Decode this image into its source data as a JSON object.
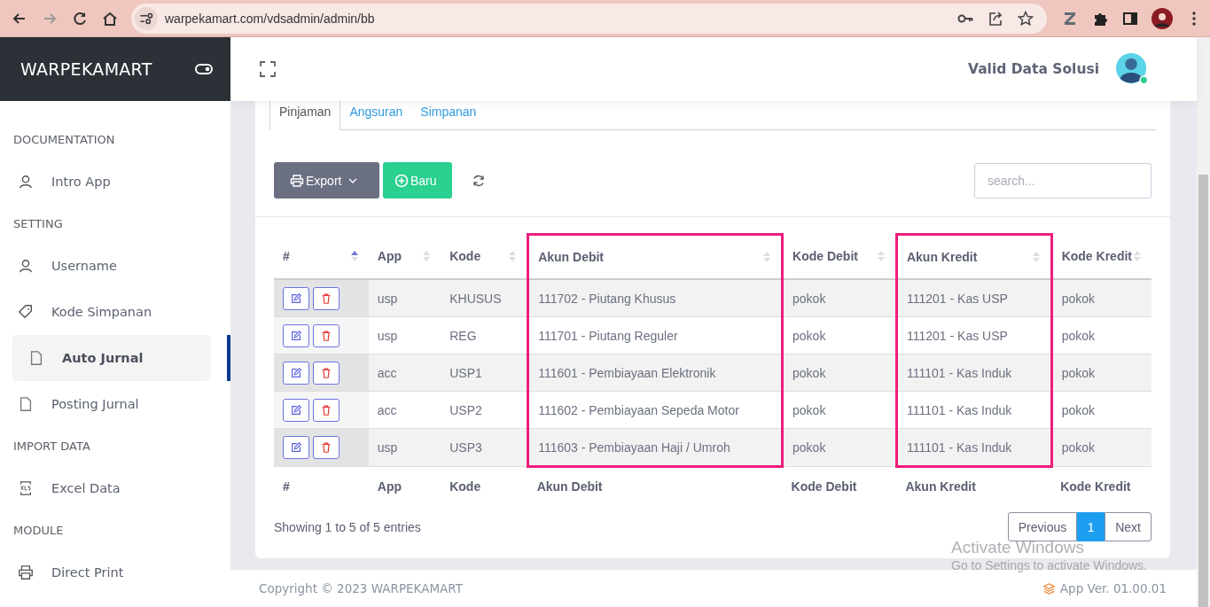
{
  "browser": {
    "url": "warpekamart.com/vdsadmin/admin/bb",
    "forward_disabled": true
  },
  "sidebar": {
    "brand": "WARPEKAMART",
    "sections": [
      {
        "title": "DOCUMENTATION",
        "items": [
          {
            "label": "Intro App",
            "kind": "user",
            "selected": false
          }
        ]
      },
      {
        "title": "SETTING",
        "items": [
          {
            "label": "Username",
            "kind": "user",
            "selected": false
          },
          {
            "label": "Kode Simpanan",
            "kind": "tag",
            "selected": false
          },
          {
            "label": "Auto Jurnal",
            "kind": "file",
            "selected": true
          },
          {
            "label": "Posting Jurnal",
            "kind": "file",
            "selected": false
          }
        ]
      },
      {
        "title": "IMPORT DATA",
        "items": [
          {
            "label": "Excel Data",
            "kind": "spreadsheet",
            "selected": false
          }
        ]
      },
      {
        "title": "MODULE",
        "items": [
          {
            "label": "Direct Print",
            "kind": "printer",
            "selected": false
          }
        ]
      }
    ]
  },
  "header": {
    "user": "Valid Data Solusi",
    "online": true
  },
  "tabs": [
    {
      "label": "Pinjaman",
      "selected": true
    },
    {
      "label": "Angsuran",
      "selected": false
    },
    {
      "label": "Simpanan",
      "selected": false
    }
  ],
  "toolbar": {
    "export": "Export",
    "new": "Baru",
    "search": {
      "placeholder": "search..."
    }
  },
  "table": {
    "columns": [
      {
        "label": "#",
        "sorted": true,
        "highlighted": false
      },
      {
        "label": "App",
        "sorted": false,
        "highlighted": false
      },
      {
        "label": "Kode",
        "sorted": false,
        "highlighted": false
      },
      {
        "label": "Akun Debit",
        "sorted": false,
        "highlighted": true
      },
      {
        "label": "Kode Debit",
        "sorted": false,
        "highlighted": false
      },
      {
        "label": "Akun Kredit",
        "sorted": false,
        "highlighted": true
      },
      {
        "label": "Kode Kredit",
        "sorted": false,
        "highlighted": false
      }
    ],
    "rows": [
      {
        "cells": [
          "",
          "usp",
          "KHUSUS",
          "111702 - Piutang Khusus",
          "pokok",
          "111201 - Kas USP",
          "pokok"
        ]
      },
      {
        "cells": [
          "",
          "usp",
          "REG",
          "111701 - Piutang Reguler",
          "pokok",
          "111201 - Kas USP",
          "pokok"
        ]
      },
      {
        "cells": [
          "",
          "acc",
          "USP1",
          "111601 - Pembiayaan Elektronik",
          "pokok",
          "111101 - Kas Induk",
          "pokok"
        ]
      },
      {
        "cells": [
          "",
          "acc",
          "USP2",
          "111602 - Pembiayaan Sepeda Motor",
          "pokok",
          "111101 - Kas Induk",
          "pokok"
        ]
      },
      {
        "cells": [
          "",
          "usp",
          "USP3",
          "111603 - Pembiayaan Haji / Umroh",
          "pokok",
          "111101 - Kas Induk",
          "pokok"
        ]
      }
    ],
    "footer_columns": [
      "#",
      "App",
      "Kode",
      "Akun Debit",
      "Kode Debit",
      "Akun Kredit",
      "Kode Kredit"
    ]
  },
  "info": "Showing 1 to 5 of 5 entries",
  "pagination": [
    {
      "label": "Previous",
      "kind": "nav",
      "selected": false
    },
    {
      "label": "1",
      "kind": "page",
      "selected": true
    },
    {
      "label": "Next",
      "kind": "nav",
      "selected": false
    }
  ],
  "os_notice": {
    "title": "Activate Windows",
    "text": "Go to Settings to activate Windows."
  },
  "footer": {
    "copyright": "Copyright © 2023 WARPEKAMART",
    "version": "App Ver. 01.00.01"
  }
}
